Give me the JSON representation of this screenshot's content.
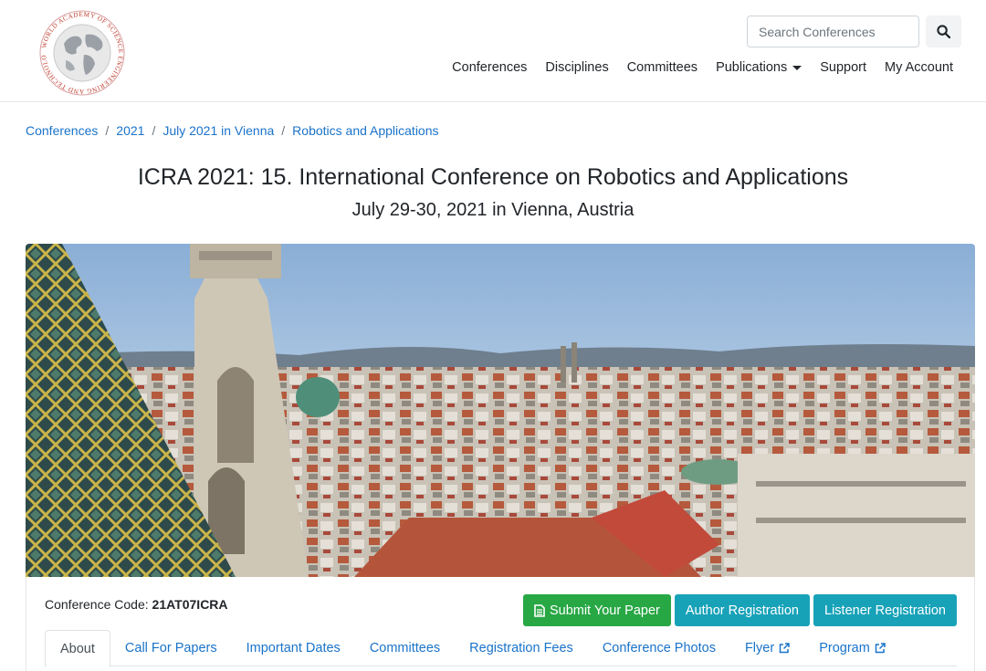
{
  "header": {
    "logo_text": "WORLD ACADEMY OF SCIENCE ENGINEERING AND TECHNOLOGY",
    "search": {
      "placeholder": "Search Conferences"
    },
    "nav": [
      {
        "label": "Conferences"
      },
      {
        "label": "Disciplines"
      },
      {
        "label": "Committees"
      },
      {
        "label": "Publications",
        "has_dropdown": true
      },
      {
        "label": "Support"
      },
      {
        "label": "My Account"
      }
    ]
  },
  "breadcrumb": [
    {
      "label": "Conferences"
    },
    {
      "label": "2021"
    },
    {
      "label": "July 2021 in Vienna"
    },
    {
      "label": "Robotics and Applications"
    }
  ],
  "conference": {
    "title": "ICRA 2021: 15. International Conference on Robotics and Applications",
    "subtitle": "July 29-30, 2021 in Vienna, Austria",
    "code_label": "Conference Code:",
    "code": "21AT07ICRA"
  },
  "actions": {
    "submit_paper": "Submit Your Paper",
    "author_registration": "Author Registration",
    "listener_registration": "Listener Registration"
  },
  "tabs": [
    {
      "label": "About",
      "active": true
    },
    {
      "label": "Call For Papers"
    },
    {
      "label": "Important Dates"
    },
    {
      "label": "Committees"
    },
    {
      "label": "Registration Fees"
    },
    {
      "label": "Conference Photos"
    },
    {
      "label": "Flyer",
      "external": true
    },
    {
      "label": "Program",
      "external": true
    }
  ],
  "colors": {
    "link": "#1a73c9",
    "success": "#28a745",
    "info": "#17a2b8",
    "logo": "#c0392b"
  },
  "icons": {
    "search": "search-icon",
    "submit": "file-text-icon",
    "external": "external-link-icon",
    "dropdown": "caret-down-icon"
  }
}
